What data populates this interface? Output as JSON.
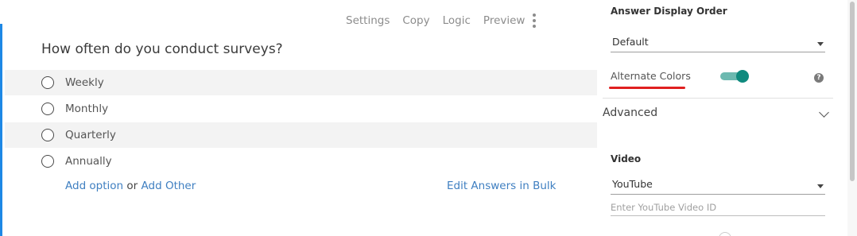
{
  "toolbar": {
    "settings": "Settings",
    "copy": "Copy",
    "logic": "Logic",
    "preview": "Preview"
  },
  "question": {
    "title": "How often do you conduct surveys?",
    "answers": [
      "Weekly",
      "Monthly",
      "Quarterly",
      "Annually"
    ],
    "add_option": "Add option",
    "or": "or",
    "add_other": "Add Other",
    "edit_bulk": "Edit Answers in Bulk"
  },
  "panel": {
    "answer_display_order_label": "Answer Display Order",
    "answer_display_order_value": "Default",
    "alternate_colors_label": "Alternate Colors",
    "alternate_colors_on": true,
    "help": "?",
    "advanced_label": "Advanced",
    "video_label": "Video",
    "video_source_value": "YouTube",
    "video_id_placeholder": "Enter YouTube Video ID"
  },
  "colors": {
    "accent_blue": "#1e88e5",
    "link": "#3f7fc1",
    "toggle_on": "#0f8a7e",
    "annotation_red": "#e02020"
  }
}
